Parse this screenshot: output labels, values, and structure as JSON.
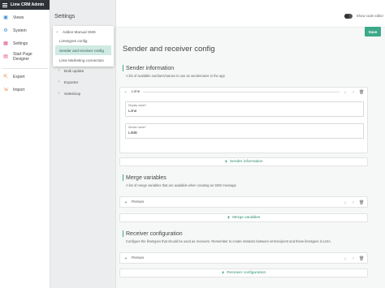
{
  "app": {
    "title": "Lime CRM Admin"
  },
  "nav": {
    "items": [
      {
        "label": "Views",
        "icon": "views-icon",
        "color": "#3b8fd6"
      },
      {
        "label": "System",
        "icon": "system-icon",
        "color": "#3b8fd6"
      },
      {
        "label": "Settings",
        "icon": "settings-icon",
        "color": "#e0458a"
      },
      {
        "label": "Start Page Designer",
        "icon": "start-page-icon",
        "color": "#e0458a"
      }
    ],
    "secondary": [
      {
        "label": "Export",
        "icon": "export-icon",
        "color": "#e07a3a"
      },
      {
        "label": "Import",
        "icon": "import-icon",
        "color": "#e07a3a"
      }
    ]
  },
  "settings_panel": {
    "title": "Settings",
    "root": {
      "label": "Addon Manual SMS"
    },
    "sub_items": [
      {
        "label": "Limetypes config"
      },
      {
        "label": "Sender and receiver config",
        "active": true
      },
      {
        "label": "Lime Marketing connection"
      }
    ],
    "nodes": [
      {
        "label": "Bulk update"
      },
      {
        "label": "Exporter"
      },
      {
        "label": "Salesloop"
      }
    ]
  },
  "toolbar": {
    "toggle_label": "Show code editor",
    "save_label": "Save"
  },
  "main": {
    "title": "Sender and receiver config",
    "sender": {
      "heading": "Sender information",
      "description": "A list of available numbers/names to use as sendername in the app",
      "item_title": "Lime",
      "display_label": "Display name*",
      "display_value": "Lime",
      "sender_label": "Sender name*",
      "sender_value": "LIME",
      "add_label": "Sender information"
    },
    "merge": {
      "heading": "Merge variables",
      "description": "A list of merge variables that are available when creating an SMS message",
      "item_title": "Person",
      "add_label": "Merge variables"
    },
    "receiver": {
      "heading": "Receiver configuration",
      "description": "Configure the limetypes that should be used as receivers. Remember to create relations between smsrecipient and these limetypes in LISA.",
      "item_title": "Person",
      "add_label": "Receiver configuration"
    }
  }
}
